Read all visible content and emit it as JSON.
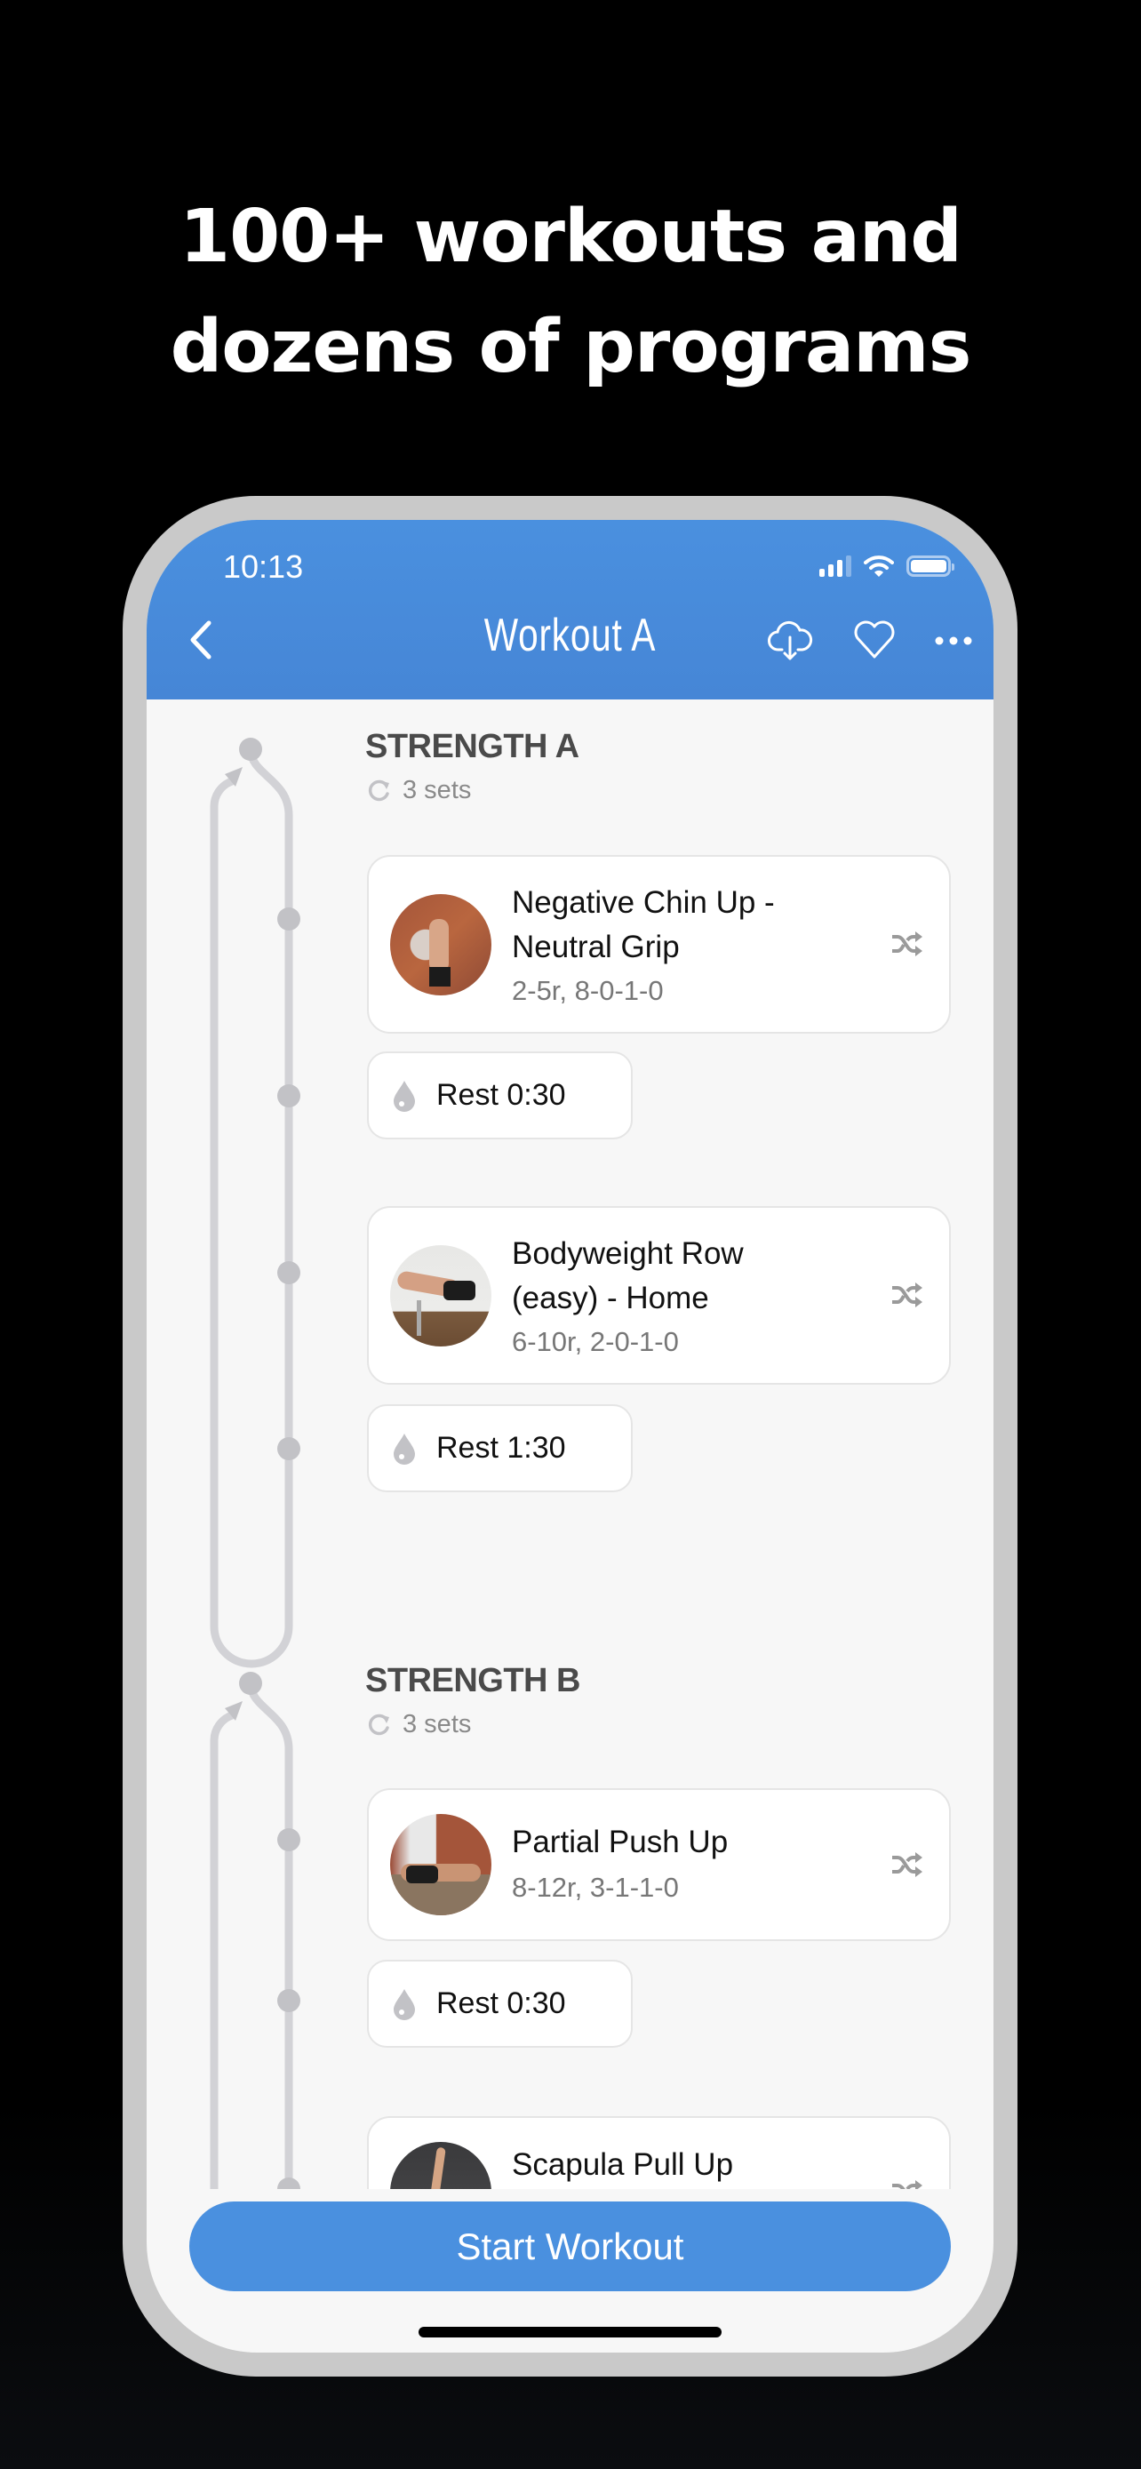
{
  "promo": {
    "headline_line1": "100+ workouts and",
    "headline_line2": "dozens of programs"
  },
  "status_bar": {
    "time": "10:13",
    "icons": [
      "cellular-signal-icon",
      "wifi-icon",
      "battery-icon"
    ]
  },
  "nav": {
    "title": "Workout A",
    "back_icon": "chevron-left-icon",
    "actions": [
      {
        "name": "download",
        "icon": "cloud-download-icon"
      },
      {
        "name": "favorite",
        "icon": "heart-icon"
      },
      {
        "name": "more",
        "icon": "ellipsis-icon"
      }
    ]
  },
  "sections": [
    {
      "title": "STRENGTH A",
      "sets": "3 sets",
      "items": [
        {
          "type": "exercise",
          "name_line1": "Negative Chin Up -",
          "name_line2": "Neutral Grip",
          "detail": "2-5r, 8-0-1-0"
        },
        {
          "type": "rest",
          "label": "Rest 0:30"
        },
        {
          "type": "exercise",
          "name_line1": "Bodyweight Row",
          "name_line2": "(easy) - Home",
          "detail": "6-10r, 2-0-1-0"
        },
        {
          "type": "rest",
          "label": "Rest 1:30"
        }
      ]
    },
    {
      "title": "STRENGTH B",
      "sets": "3 sets",
      "items": [
        {
          "type": "exercise",
          "name_line1": "Partial Push Up",
          "detail": "8-12r, 3-1-1-0"
        },
        {
          "type": "rest",
          "label": "Rest 0:30"
        },
        {
          "type": "exercise",
          "name_line1": "Scapula Pull Up"
        }
      ]
    }
  ],
  "footer": {
    "start_button": "Start Workout"
  },
  "colors": {
    "accent": "#4a90df",
    "background": "#000000",
    "screen_bg": "#f7f7f7",
    "track": "#d2d2d6",
    "frame": "#c9c9c9"
  }
}
